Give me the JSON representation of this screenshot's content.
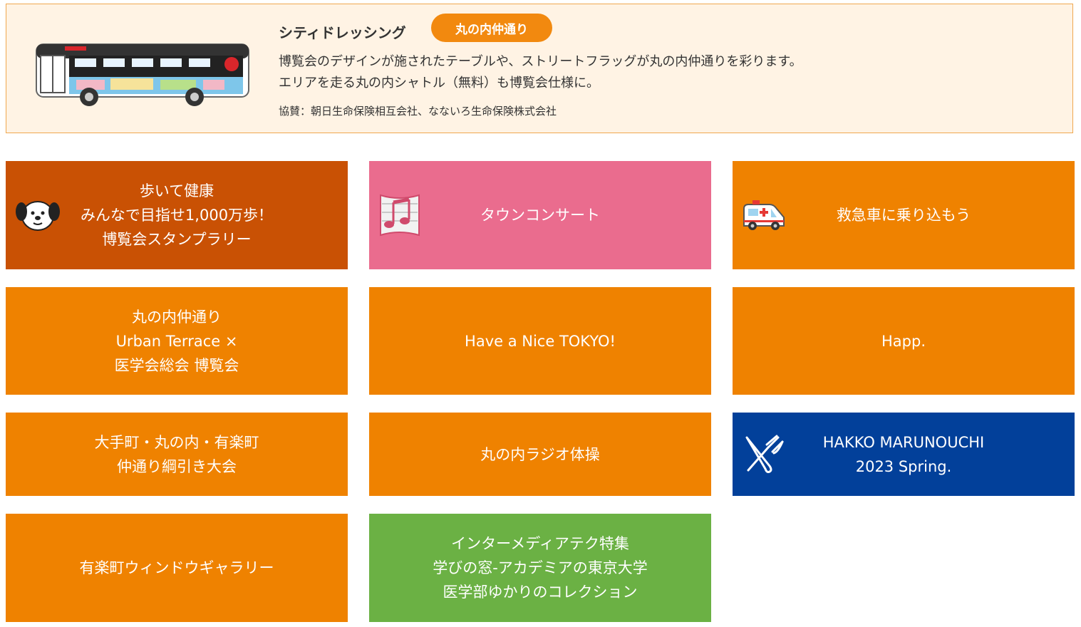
{
  "banner": {
    "title": "シティドレッシング",
    "badge": "丸の内仲通り",
    "description": "博覧会のデザインが施されたテーブルや、ストリートフラッグが丸の内仲通りを彩ります。\nエリアを走る丸の内シャトル（無料）も博覧会仕様に。",
    "sponsor": "協賛：朝日生命保険相互会社、なないろ生命保険株式会社",
    "image_icon": "bus-icon"
  },
  "tiles": [
    {
      "label": "歩いて健康\nみんなで目指せ1,000万歩！\n博覧会スタンプラリー",
      "icon": "dog-icon",
      "color": "#c95104"
    },
    {
      "label": "タウンコンサート",
      "icon": "music-note-icon",
      "color": "#ea6c8e"
    },
    {
      "label": "救急車に乗り込もう",
      "icon": "ambulance-icon",
      "color": "#ef8200"
    },
    {
      "label": "丸の内仲通り\nUrban Terrace ×\n医学会総会 博覧会",
      "color": "#ef8200"
    },
    {
      "label": "Have a Nice TOKYO!",
      "color": "#ef8200"
    },
    {
      "label": "Happ.",
      "color": "#ef8200"
    },
    {
      "label": "大手町・丸の内・有楽町\n仲通り綱引き大会",
      "color": "#ef8200"
    },
    {
      "label": "丸の内ラジオ体操",
      "color": "#ef8200"
    },
    {
      "label": "HAKKO MARUNOUCHI\n2023 Spring.",
      "icon": "fork-knife-icon",
      "color": "#02409a"
    },
    {
      "label": "有楽町ウィンドウギャラリー",
      "color": "#ef8200"
    },
    {
      "label": "インターメディアテク特集\n学びの窓-アカデミアの東京大学\n医学部ゆかりのコレクション",
      "color": "#6bb144"
    }
  ]
}
